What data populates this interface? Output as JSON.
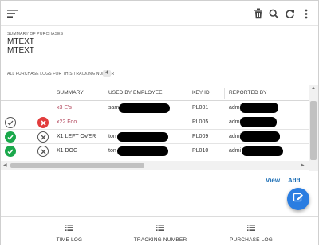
{
  "toolbar": {
    "menu_icon": "menu-icon",
    "actions": [
      "trash-icon",
      "search-icon",
      "refresh-icon",
      "more-vertical-icon"
    ]
  },
  "summary": {
    "label": "SUMMARY OF PURCHASES",
    "lines": [
      "MTEXT",
      "MTEXT"
    ]
  },
  "logs": {
    "label": "ALL PURCHASE LOGS FOR THIS TRACKING NUMBER",
    "count": "4",
    "columns": [
      "SUMMARY",
      "USED BY EMPLOYEE",
      "KEY ID",
      "REPORTED BY"
    ],
    "rows": [
      {
        "status_a": "",
        "status_b": "",
        "summary": "x3 E's",
        "employee": "sam",
        "key_id": "PL001",
        "reported_by": "admi"
      },
      {
        "status_a": "check-outline",
        "status_b": "x-red",
        "summary": "x22 Foo",
        "employee": "",
        "key_id": "PL005",
        "reported_by": "admi"
      },
      {
        "status_a": "check-green",
        "status_b": "x-outline",
        "summary": "X1 LEFT OVER",
        "employee": "ton",
        "key_id": "PL009",
        "reported_by": "admi"
      },
      {
        "status_a": "check-green",
        "status_b": "x-outline",
        "summary": "X1 DOG",
        "employee": "ton",
        "key_id": "PL010",
        "reported_by": "admi"
      }
    ]
  },
  "links": {
    "view": "View",
    "add": "Add"
  },
  "fab_icon": "edit-icon",
  "nav": {
    "items": [
      {
        "label": "TIME LOG",
        "icon": "list-icon"
      },
      {
        "label": "TRACKING NUMBER",
        "icon": "list-icon"
      },
      {
        "label": "PURCHASE LOG",
        "icon": "list-icon"
      }
    ]
  },
  "colors": {
    "accent": "#2a7de1",
    "link": "#1e6fb5",
    "ok": "#1aa84b",
    "error": "#e23d3d",
    "summary_text": "#b2455b"
  }
}
